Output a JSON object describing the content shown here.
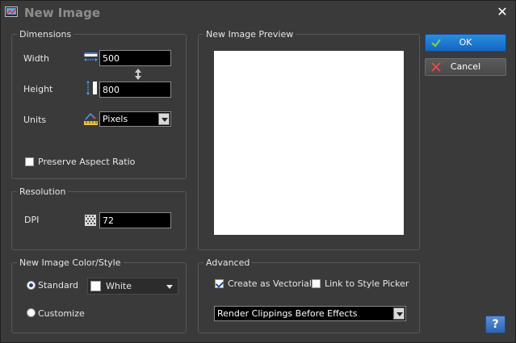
{
  "window": {
    "title": "New Image"
  },
  "dimensions": {
    "group_label": "Dimensions",
    "width_label": "Width",
    "width_value": "500",
    "height_label": "Height",
    "height_value": "800",
    "units_label": "Units",
    "units_value": "Pixels",
    "preserve_label": "Preserve Aspect Ratio",
    "preserve_checked": false
  },
  "resolution": {
    "group_label": "Resolution",
    "dpi_label": "DPI",
    "dpi_value": "72"
  },
  "color_style": {
    "group_label": "New Image Color/Style",
    "standard_label": "Standard",
    "standard_selected": true,
    "color_value": "White",
    "customize_label": "Customize"
  },
  "preview": {
    "group_label": "New Image Preview"
  },
  "advanced": {
    "group_label": "Advanced",
    "vectorial_label": "Create as Vectorial",
    "vectorial_checked": true,
    "link_label": "Link to Style Picker",
    "link_checked": false,
    "render_value": "Render Clippings Before Effects"
  },
  "buttons": {
    "ok_label": "OK",
    "cancel_label": "Cancel",
    "help_label": "?"
  },
  "colors": {
    "accent": "#1a73d0",
    "background": "#3a3a3a",
    "field_bg": "#000000"
  }
}
